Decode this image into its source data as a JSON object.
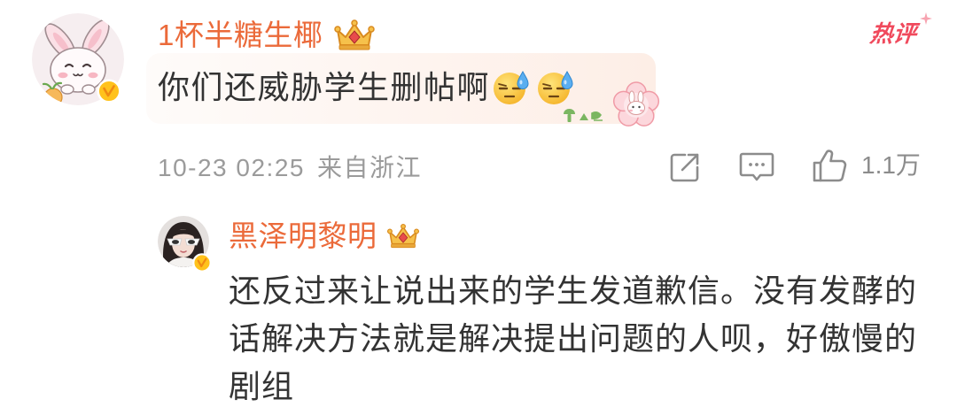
{
  "colors": {
    "background": "#ffffff",
    "text": "#333333",
    "username": "#eb6a3a",
    "meta": "#9b9b9b",
    "icon": "#8c8c8c",
    "hot_badge": "#f0495c",
    "verified": "#ffc21c",
    "bubble": "#fdeee6"
  },
  "comment": {
    "avatar_icon": "bunny-avatar",
    "verified_icon": "verified-v-icon",
    "username": "1杯半糖生椰",
    "member_icon": "crown-icon",
    "hot_badge": "热评",
    "text": "你们还威胁学生删帖啊",
    "emojis": [
      "sweat-face-emoji",
      "sweat-face-emoji"
    ],
    "sticker_icon": "flower-bunny-sticker",
    "timestamp": "10-23 02:25",
    "location": "来自浙江",
    "actions": {
      "repost_icon": "repost-icon",
      "comment_icon": "comment-icon",
      "like_icon": "thumbs-up-icon",
      "like_count": "1.1万"
    }
  },
  "reply": {
    "avatar_icon": "girl-sunglasses-avatar",
    "verified_icon": "verified-v-icon",
    "username": "黑泽明黎明",
    "member_icon": "crown-icon",
    "text_lines": [
      "还反过来让说出来的学生发道歉信。没有发酵的",
      "话解决方法就是解决提出问题的人呗，好傲慢的",
      "剧组"
    ]
  }
}
